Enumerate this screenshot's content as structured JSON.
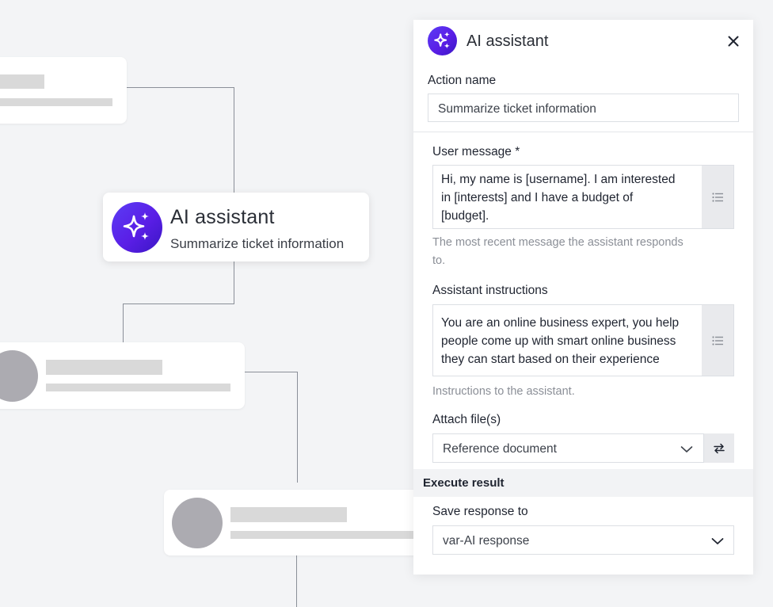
{
  "canvas": {
    "ai_node": {
      "title": "AI assistant",
      "subtitle": "Summarize ticket information",
      "icon": "sparkles-icon"
    }
  },
  "panel": {
    "title": "AI assistant",
    "header_icon": "sparkles-icon",
    "close_icon": "close-icon",
    "action_name": {
      "label": "Action name",
      "value": "Summarize ticket information"
    },
    "user_message": {
      "label": "User message *",
      "lines": [
        "Hi, my name is [username]. I am interested",
        "in [interests] and I have a budget of",
        "[budget]."
      ],
      "hint_lines": [
        "The most recent message the assistant responds",
        "to."
      ],
      "icon": "list-icon"
    },
    "assistant_instructions": {
      "label": "Assistant instructions",
      "lines": [
        "You are an online business expert, you help",
        "people come up with smart online business",
        "they can start based on their experience"
      ],
      "hint": "Instructions to the assistant.",
      "icon": "list-icon"
    },
    "attach_files": {
      "label": "Attach file(s)",
      "selected": "Reference document",
      "icon": "swap-icon"
    },
    "execute_result": {
      "section_title": "Execute result",
      "save_label": "Save response to",
      "selected": "var-AI response"
    }
  },
  "colors": {
    "accent": "#5a1ee6",
    "background": "#f3f4f6",
    "connector": "#8a8f98"
  }
}
